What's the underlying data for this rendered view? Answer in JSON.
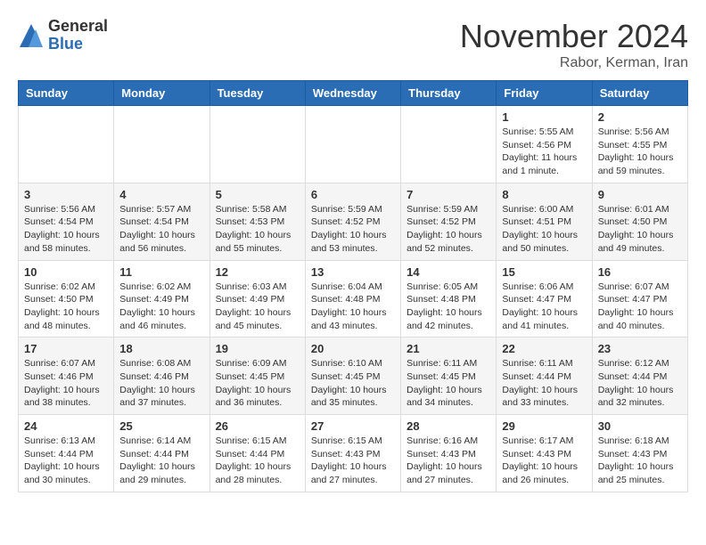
{
  "logo": {
    "general": "General",
    "blue": "Blue"
  },
  "title": "November 2024",
  "location": "Rabor, Kerman, Iran",
  "days_of_week": [
    "Sunday",
    "Monday",
    "Tuesday",
    "Wednesday",
    "Thursday",
    "Friday",
    "Saturday"
  ],
  "weeks": [
    [
      {
        "day": "",
        "info": ""
      },
      {
        "day": "",
        "info": ""
      },
      {
        "day": "",
        "info": ""
      },
      {
        "day": "",
        "info": ""
      },
      {
        "day": "",
        "info": ""
      },
      {
        "day": "1",
        "info": "Sunrise: 5:55 AM\nSunset: 4:56 PM\nDaylight: 11 hours\nand 1 minute."
      },
      {
        "day": "2",
        "info": "Sunrise: 5:56 AM\nSunset: 4:55 PM\nDaylight: 10 hours\nand 59 minutes."
      }
    ],
    [
      {
        "day": "3",
        "info": "Sunrise: 5:56 AM\nSunset: 4:54 PM\nDaylight: 10 hours\nand 58 minutes."
      },
      {
        "day": "4",
        "info": "Sunrise: 5:57 AM\nSunset: 4:54 PM\nDaylight: 10 hours\nand 56 minutes."
      },
      {
        "day": "5",
        "info": "Sunrise: 5:58 AM\nSunset: 4:53 PM\nDaylight: 10 hours\nand 55 minutes."
      },
      {
        "day": "6",
        "info": "Sunrise: 5:59 AM\nSunset: 4:52 PM\nDaylight: 10 hours\nand 53 minutes."
      },
      {
        "day": "7",
        "info": "Sunrise: 5:59 AM\nSunset: 4:52 PM\nDaylight: 10 hours\nand 52 minutes."
      },
      {
        "day": "8",
        "info": "Sunrise: 6:00 AM\nSunset: 4:51 PM\nDaylight: 10 hours\nand 50 minutes."
      },
      {
        "day": "9",
        "info": "Sunrise: 6:01 AM\nSunset: 4:50 PM\nDaylight: 10 hours\nand 49 minutes."
      }
    ],
    [
      {
        "day": "10",
        "info": "Sunrise: 6:02 AM\nSunset: 4:50 PM\nDaylight: 10 hours\nand 48 minutes."
      },
      {
        "day": "11",
        "info": "Sunrise: 6:02 AM\nSunset: 4:49 PM\nDaylight: 10 hours\nand 46 minutes."
      },
      {
        "day": "12",
        "info": "Sunrise: 6:03 AM\nSunset: 4:49 PM\nDaylight: 10 hours\nand 45 minutes."
      },
      {
        "day": "13",
        "info": "Sunrise: 6:04 AM\nSunset: 4:48 PM\nDaylight: 10 hours\nand 43 minutes."
      },
      {
        "day": "14",
        "info": "Sunrise: 6:05 AM\nSunset: 4:48 PM\nDaylight: 10 hours\nand 42 minutes."
      },
      {
        "day": "15",
        "info": "Sunrise: 6:06 AM\nSunset: 4:47 PM\nDaylight: 10 hours\nand 41 minutes."
      },
      {
        "day": "16",
        "info": "Sunrise: 6:07 AM\nSunset: 4:47 PM\nDaylight: 10 hours\nand 40 minutes."
      }
    ],
    [
      {
        "day": "17",
        "info": "Sunrise: 6:07 AM\nSunset: 4:46 PM\nDaylight: 10 hours\nand 38 minutes."
      },
      {
        "day": "18",
        "info": "Sunrise: 6:08 AM\nSunset: 4:46 PM\nDaylight: 10 hours\nand 37 minutes."
      },
      {
        "day": "19",
        "info": "Sunrise: 6:09 AM\nSunset: 4:45 PM\nDaylight: 10 hours\nand 36 minutes."
      },
      {
        "day": "20",
        "info": "Sunrise: 6:10 AM\nSunset: 4:45 PM\nDaylight: 10 hours\nand 35 minutes."
      },
      {
        "day": "21",
        "info": "Sunrise: 6:11 AM\nSunset: 4:45 PM\nDaylight: 10 hours\nand 34 minutes."
      },
      {
        "day": "22",
        "info": "Sunrise: 6:11 AM\nSunset: 4:44 PM\nDaylight: 10 hours\nand 33 minutes."
      },
      {
        "day": "23",
        "info": "Sunrise: 6:12 AM\nSunset: 4:44 PM\nDaylight: 10 hours\nand 32 minutes."
      }
    ],
    [
      {
        "day": "24",
        "info": "Sunrise: 6:13 AM\nSunset: 4:44 PM\nDaylight: 10 hours\nand 30 minutes."
      },
      {
        "day": "25",
        "info": "Sunrise: 6:14 AM\nSunset: 4:44 PM\nDaylight: 10 hours\nand 29 minutes."
      },
      {
        "day": "26",
        "info": "Sunrise: 6:15 AM\nSunset: 4:44 PM\nDaylight: 10 hours\nand 28 minutes."
      },
      {
        "day": "27",
        "info": "Sunrise: 6:15 AM\nSunset: 4:43 PM\nDaylight: 10 hours\nand 27 minutes."
      },
      {
        "day": "28",
        "info": "Sunrise: 6:16 AM\nSunset: 4:43 PM\nDaylight: 10 hours\nand 27 minutes."
      },
      {
        "day": "29",
        "info": "Sunrise: 6:17 AM\nSunset: 4:43 PM\nDaylight: 10 hours\nand 26 minutes."
      },
      {
        "day": "30",
        "info": "Sunrise: 6:18 AM\nSunset: 4:43 PM\nDaylight: 10 hours\nand 25 minutes."
      }
    ]
  ]
}
